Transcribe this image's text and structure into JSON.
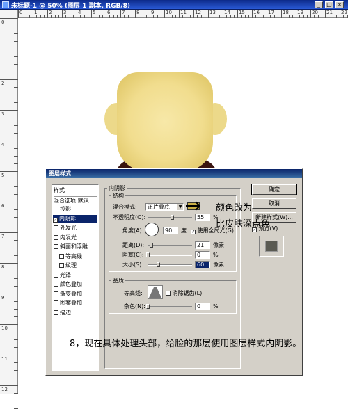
{
  "window": {
    "title": "未标题-1 @ 50% (图层 1 副本, RGB/8)",
    "buttons": {
      "minimize": "_",
      "maximize": "□",
      "close": "×"
    }
  },
  "ruler": {
    "top_labels": [
      "0",
      "1",
      "2",
      "3",
      "4",
      "5",
      "6",
      "7",
      "8",
      "9",
      "10",
      "11",
      "12",
      "13",
      "14",
      "15",
      "16",
      "17",
      "18",
      "19",
      "20",
      "21",
      "22"
    ],
    "left_labels": [
      "0",
      "1",
      "2",
      "3",
      "4",
      "5",
      "6",
      "7",
      "8",
      "9",
      "10",
      "11",
      "12"
    ]
  },
  "dialog": {
    "title": "图层样式",
    "style_list": [
      {
        "label": "样式",
        "checkbox": false
      },
      {
        "label": "混合选项:默认",
        "checkbox": false
      },
      {
        "label": "投影",
        "checkbox": true,
        "checked": false
      },
      {
        "label": "内阴影",
        "checkbox": true,
        "checked": true,
        "selected": true
      },
      {
        "label": "外发光",
        "checkbox": true,
        "checked": false
      },
      {
        "label": "内发光",
        "checkbox": true,
        "checked": false
      },
      {
        "label": "斜面和浮雕",
        "checkbox": true,
        "checked": false
      },
      {
        "label": "等高线",
        "checkbox": true,
        "checked": false,
        "indent": true
      },
      {
        "label": "纹理",
        "checkbox": true,
        "checked": false,
        "indent": true
      },
      {
        "label": "光泽",
        "checkbox": true,
        "checked": false
      },
      {
        "label": "颜色叠加",
        "checkbox": true,
        "checked": false
      },
      {
        "label": "渐变叠加",
        "checkbox": true,
        "checked": false
      },
      {
        "label": "图案叠加",
        "checkbox": true,
        "checked": false
      },
      {
        "label": "描边",
        "checkbox": true,
        "checked": false
      }
    ],
    "inner_shadow": {
      "group_label": "内阴影",
      "structure_label": "结构",
      "blend_mode_label": "混合模式:",
      "blend_mode_value": "正片叠底",
      "shadow_color": "#c9ae45",
      "opacity_label": "不透明度(O):",
      "opacity_value": "55",
      "opacity_level": 0.55,
      "percent": "%",
      "angle_label": "角度(A):",
      "angle_value": "90",
      "degree": "度",
      "global_light_label": "使用全局光(G)",
      "global_light_checked": true,
      "distance_label": "距离(D):",
      "distance_value": "21",
      "distance_level": 0.08,
      "choke_label": "阻塞(C):",
      "choke_value": "0",
      "choke_level": 0,
      "size_label": "大小(S):",
      "size_value": "60",
      "size_level": 0.24,
      "px": "像素",
      "quality_label": "品质",
      "contour_label": "等高线:",
      "anti_alias_label": "消除锯齿(L)",
      "noise_label": "杂色(N):",
      "noise_value": "0",
      "noise_level": 0
    },
    "buttons": {
      "ok": "确定",
      "cancel": "取消",
      "new_style": "新建样式(W)...",
      "preview": "预览(V)"
    }
  },
  "annotation": {
    "line1": "颜色改为",
    "line2": "比皮肤深点色"
  },
  "instruction": "8，现在具体处理头部，给脸的那层使用图层样式内阴影。"
}
